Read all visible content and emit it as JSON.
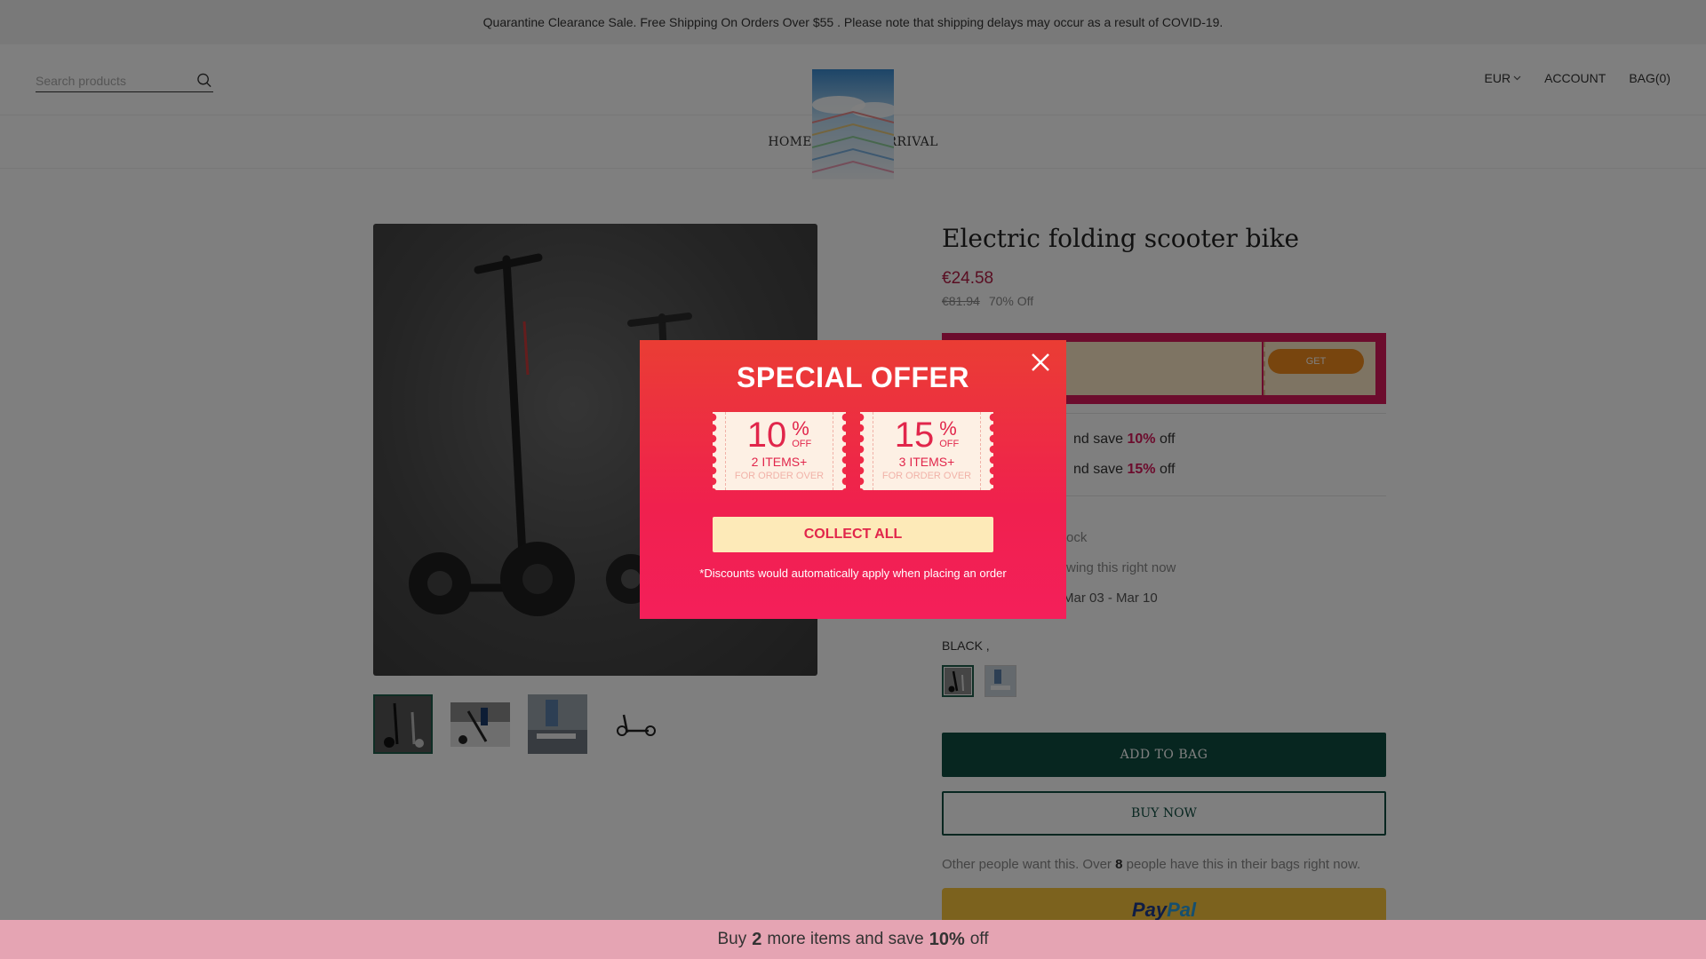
{
  "announcement": "Quarantine Clearance Sale. Free Shipping On Orders Over $55 . Please note that shipping delays may occur as a result of COVID-19.",
  "header": {
    "search_placeholder": "Search products",
    "currency": "EUR",
    "account": "ACCOUNT",
    "bag": "BAG(0)"
  },
  "nav": {
    "items": [
      "HOME",
      "NEW ARRIVAL"
    ]
  },
  "product": {
    "title": "Electric folding scooter bike",
    "price": "€24.58",
    "old_price": "€81.94",
    "discount": "70% Off",
    "coupon_get": "GET",
    "tiers": [
      {
        "prefix": "nd save ",
        "pct": "10%",
        "suffix": " off"
      },
      {
        "prefix": "nd save ",
        "pct": "15%",
        "suffix": " off"
      }
    ],
    "meta": {
      "stock": "ock",
      "viewers": "wing this right now",
      "delivery": "Mar 03 - Mar 10"
    },
    "color_label": "BLACK ,",
    "add_to_bag": "ADD TO BAG",
    "buy_now": "BUY NOW",
    "social": {
      "prefix": "Other people want this. Over ",
      "count": "8",
      "suffix": " people have this in their bags right now."
    },
    "paypal": {
      "p1": "Pay",
      "p2": "Pal"
    }
  },
  "bottom_bar": {
    "prefix": "Buy ",
    "count": "2",
    "middle": " more items and save ",
    "pct": "10%",
    "suffix": " off"
  },
  "modal": {
    "title": "SPECIAL OFFER",
    "coupons": [
      {
        "value": "10",
        "pct": "%",
        "off": "OFF",
        "items": "2 ITEMS+",
        "over": "FOR ORDER OVER"
      },
      {
        "value": "15",
        "pct": "%",
        "off": "OFF",
        "items": "3 ITEMS+",
        "over": "FOR ORDER OVER"
      }
    ],
    "collect": "COLLECT ALL",
    "note": "*Discounts would automatically apply when placing an order"
  },
  "colors": {
    "accent": "#0f4d40",
    "sale": "#b31d45",
    "modal": "#f0204e",
    "coupon_bar": "#d9185b"
  }
}
